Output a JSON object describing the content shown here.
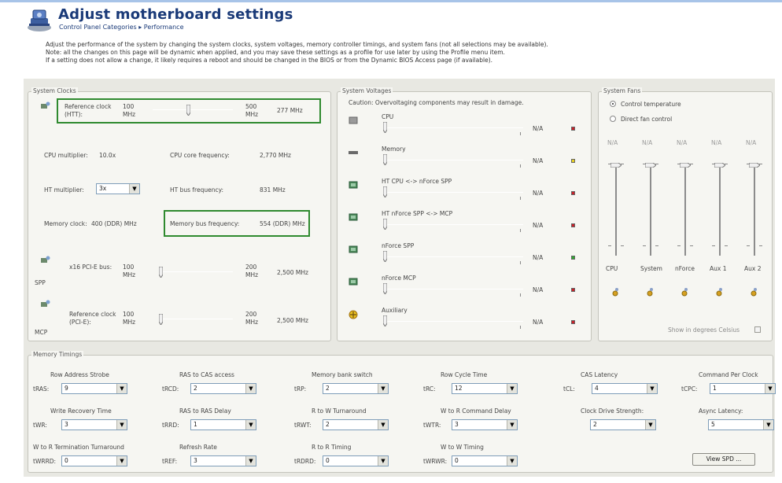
{
  "header": {
    "title": "Adjust motherboard settings",
    "breadcrumb": "Control Panel Categories  ▸  Performance"
  },
  "intro": {
    "line1": "Adjust the performance of the system by changing the system clocks, system voltages,  memory controller timings, and system fans (not all selections may be available).",
    "line2": "Note: all the changes on this page will be dynamic when applied, and you may save these settings as a profile for use later by using the Profile menu item.",
    "line3": "If a setting does not allow a change, it likely requires a reboot and should be changed in the BIOS or from the Dynamic BIOS Access page (if available)."
  },
  "clocks": {
    "title": "System Clocks",
    "htt": {
      "label": "Reference clock (HTT):",
      "min": "100 MHz",
      "max": "500 MHz",
      "value": "277 MHz",
      "fraction": 0.44
    },
    "cpu_multiplier_label": "CPU multiplier:",
    "cpu_multiplier_value": "10.0x",
    "cpu_core_freq_label": "CPU core frequency:",
    "cpu_core_freq_value": "2,770 MHz",
    "ht_multiplier_label": "HT multiplier:",
    "ht_multiplier_value": "3x",
    "ht_bus_freq_label": "HT bus frequency:",
    "ht_bus_freq_value": "831 MHz",
    "memory_clock_label": "Memory clock:",
    "memory_clock_value": "400 (DDR) MHz",
    "memory_bus_freq_label": "Memory bus frequency:",
    "memory_bus_freq_value": "554 (DDR) MHz",
    "spp": {
      "tag": "SPP",
      "label": "x16 PCI-E bus:",
      "min": "100 MHz",
      "max": "200 MHz",
      "value": "2,500 MHz",
      "fraction": 0.0
    },
    "mcp": {
      "tag": "MCP",
      "label": "Reference clock (PCI-E):",
      "min": "100 MHz",
      "max": "200 MHz",
      "value": "2,500 MHz",
      "fraction": 0.0
    }
  },
  "voltages": {
    "title": "System Voltages",
    "caution": "Caution: Overvoltaging components may result in damage.",
    "items": [
      {
        "name": "CPU",
        "value": "N/A",
        "status_color": "#c8202a",
        "icon": "cpu-chip-icon"
      },
      {
        "name": "Memory",
        "value": "N/A",
        "status_color": "#e8d020",
        "icon": "memory-module-icon"
      },
      {
        "name": "HT CPU <-> nForce SPP",
        "value": "N/A",
        "status_color": "#c8202a",
        "icon": "chip-link-icon"
      },
      {
        "name": "HT nForce SPP <-> MCP",
        "value": "N/A",
        "status_color": "#c8202a",
        "icon": "chip-link-icon"
      },
      {
        "name": "nForce SPP",
        "value": "N/A",
        "status_color": "#30a830",
        "icon": "chipset-icon"
      },
      {
        "name": "nForce MCP",
        "value": "N/A",
        "status_color": "#c8202a",
        "icon": "chipset-icon"
      },
      {
        "name": "Auxiliary",
        "value": "N/A",
        "status_color": "#c8202a",
        "icon": "auxiliary-icon"
      }
    ]
  },
  "fans": {
    "title": "System Fans",
    "option_control": "Control temperature",
    "option_direct": "Direct fan control",
    "selected": "control",
    "items": [
      {
        "name": "CPU",
        "value": "N/A"
      },
      {
        "name": "System",
        "value": "N/A"
      },
      {
        "name": "nForce",
        "value": "N/A"
      },
      {
        "name": "Aux 1",
        "value": "N/A"
      },
      {
        "name": "Aux 2",
        "value": "N/A"
      }
    ],
    "celsius_label": "Show in degrees Celsius"
  },
  "timings": {
    "title": "Memory Timings",
    "row1": [
      {
        "caption": "Row Address Strobe",
        "short": "tRAS:",
        "value": "9"
      },
      {
        "caption": "RAS to CAS access",
        "short": "tRCD:",
        "value": "2"
      },
      {
        "caption": "Memory bank switch",
        "short": "tRP:",
        "value": "2"
      },
      {
        "caption": "Row Cycle Time",
        "short": "tRC:",
        "value": "12"
      },
      {
        "caption": "CAS Latency",
        "short": "tCL:",
        "value": "4"
      },
      {
        "caption": "Command Per Clock",
        "short": "tCPC:",
        "value": "1"
      }
    ],
    "row2": [
      {
        "caption": "Write Recovery Time",
        "short": "tWR:",
        "value": "3"
      },
      {
        "caption": "RAS to RAS Delay",
        "short": "tRRD:",
        "value": "1"
      },
      {
        "caption": "R to W Turnaround",
        "short": "tRWT:",
        "value": "2"
      },
      {
        "caption": "W to R Command Delay",
        "short": "tWTR:",
        "value": "3"
      },
      {
        "caption": "Clock Drive Strength:",
        "short": "",
        "value": "2"
      },
      {
        "caption": "Async Latency:",
        "short": "",
        "value": "5"
      }
    ],
    "row3": [
      {
        "caption": "W to R Termination Turnaround",
        "short": "tWRRD:",
        "value": "0"
      },
      {
        "caption": "Refresh Rate",
        "short": "tREF:",
        "value": "3"
      },
      {
        "caption": "R to R Timing",
        "short": "tRDRD:",
        "value": "0"
      },
      {
        "caption": "W to W Timing",
        "short": "tWRWR:",
        "value": "0"
      }
    ],
    "view_spd_label": "View SPD ..."
  }
}
